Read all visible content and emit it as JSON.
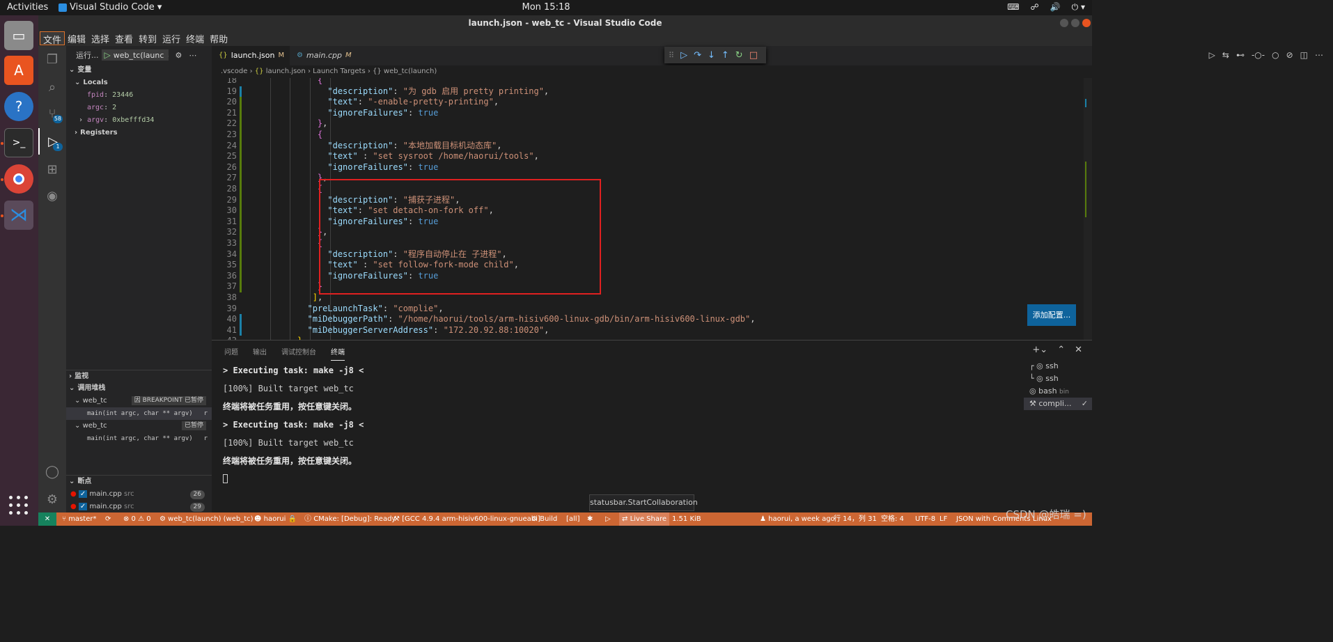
{
  "topbar": {
    "activities": "Activities",
    "app_name": "Visual Studio Code ▾",
    "clock": "Mon 15:18"
  },
  "titlebar": {
    "title": "launch.json - web_tc - Visual Studio Code"
  },
  "menu": [
    "文件",
    "编辑",
    "选择",
    "查看",
    "转到",
    "运行",
    "终端",
    "帮助"
  ],
  "activity": {
    "scm_badge": "58",
    "debug_badge": "1"
  },
  "debug": {
    "run_label": "运行...",
    "config_name": "web_tc(launc",
    "variables_title": "变量",
    "locals_title": "Locals",
    "locals": [
      {
        "name": "fpid",
        "value": "23446"
      },
      {
        "name": "argc",
        "value": "2"
      },
      {
        "name": "argv",
        "value": "0xbefffd34"
      }
    ],
    "registers_title": "Registers",
    "watch_title": "监视",
    "callstack_title": "调用堆栈",
    "threads": [
      {
        "name": "web_tc",
        "status": "因 BREAKPOINT 已暂停",
        "frame": "main(int argc, char ** argv)",
        "frame_tail": "r"
      },
      {
        "name": "web_tc",
        "status": "已暂停",
        "frame": "main(int argc, char ** argv)",
        "frame_tail": "r"
      }
    ],
    "breakpoints_title": "断点",
    "breakpoints": [
      {
        "file": "main.cpp",
        "dir": "src",
        "line": "26"
      },
      {
        "file": "main.cpp",
        "dir": "src",
        "line": "29"
      }
    ]
  },
  "tabs": [
    {
      "label": "launch.json",
      "mark": "M"
    },
    {
      "label": "main.cpp",
      "mark": "M"
    }
  ],
  "breadcrumb": {
    "p1": ".vscode",
    "p2": "launch.json",
    "p3": "Launch Targets",
    "p4": "{} web_tc(launch)"
  },
  "editor": {
    "lines": [
      {
        "n": "18",
        "t": ""
      },
      {
        "n": "19",
        "t": ""
      },
      {
        "n": "20",
        "t": ""
      },
      {
        "n": "21",
        "t": ""
      },
      {
        "n": "22",
        "t": ""
      },
      {
        "n": "23",
        "t": ""
      },
      {
        "n": "24",
        "t": ""
      },
      {
        "n": "25",
        "t": ""
      },
      {
        "n": "26",
        "t": ""
      },
      {
        "n": "27",
        "t": ""
      },
      {
        "n": "28",
        "t": ""
      },
      {
        "n": "29",
        "t": ""
      },
      {
        "n": "30",
        "t": ""
      },
      {
        "n": "31",
        "t": ""
      },
      {
        "n": "32",
        "t": ""
      },
      {
        "n": "33",
        "t": ""
      },
      {
        "n": "34",
        "t": ""
      },
      {
        "n": "35",
        "t": ""
      },
      {
        "n": "36",
        "t": ""
      },
      {
        "n": "37",
        "t": ""
      },
      {
        "n": "38",
        "t": ""
      },
      {
        "n": "39",
        "t": ""
      },
      {
        "n": "40",
        "t": ""
      },
      {
        "n": "41",
        "t": ""
      },
      {
        "n": "42",
        "t": ""
      }
    ],
    "code": [
      [
        "",
        ""
      ],
      [
        "\"description\"",
        "\"为 gdb 启用 pretty printing\""
      ],
      [
        "\"text\"",
        "\"-enable-pretty-printing\""
      ],
      [
        "\"ignoreFailures\"",
        "true"
      ],
      [
        "",
        ""
      ],
      [
        "",
        ""
      ],
      [
        "\"description\"",
        "\"本地加载目标机动态库\""
      ],
      [
        "\"text\"",
        "\"set sysroot /home/haorui/tools\""
      ],
      [
        "\"ignoreFailures\"",
        "true"
      ],
      [
        "",
        ""
      ],
      [
        "",
        ""
      ],
      [
        "\"description\"",
        "\"捕获子进程\""
      ],
      [
        "\"text\"",
        "\"set detach-on-fork off\""
      ],
      [
        "\"ignoreFailures\"",
        "true"
      ],
      [
        "",
        ""
      ],
      [
        "",
        ""
      ],
      [
        "\"description\"",
        "\"程序自动停止在 子进程\""
      ],
      [
        "\"text\"",
        "\"set follow-fork-mode child\""
      ],
      [
        "\"ignoreFailures\"",
        "true"
      ],
      [
        "",
        ""
      ],
      [
        "",
        ""
      ],
      [
        "\"preLaunchTask\"",
        "\"complie\""
      ],
      [
        "\"miDebuggerPath\"",
        "\"/home/haorui/tools/arm-hisiv600-linux-gdb/bin/arm-hisiv600-linux-gdb\""
      ],
      [
        "\"miDebuggerServerAddress\"",
        "\"172.20.92.88:10020\""
      ],
      [
        "",
        ""
      ]
    ],
    "add_config": "添加配置..."
  },
  "panel": {
    "tabs": [
      "问题",
      "输出",
      "调试控制台",
      "终端"
    ],
    "terminal_lines": [
      "> Executing task: make -j8 <",
      "[100%] Built target web_tc",
      "终端将被任务重用，按任意键关闭。",
      "> Executing task: make -j8 <",
      "[100%] Built target web_tc",
      "终端将被任务重用，按任意键关闭。"
    ],
    "terminals": [
      {
        "name": "ssh",
        "sub": ""
      },
      {
        "name": "ssh",
        "sub": ""
      },
      {
        "name": "bash",
        "sub": "bin"
      },
      {
        "name": "compli...",
        "sub": ""
      }
    ]
  },
  "tooltip": "statusbar.StartCollaboration",
  "status": {
    "branch": "master*",
    "problems": "⊗ 0 ⚠ 0",
    "launch": "web_tc(launch) (web_tc)",
    "user": "haorui",
    "cmake": "CMake: [Debug]: Ready",
    "kit": "[GCC 4.9.4 arm-hisiv600-linux-gnueabi]",
    "build": "Build",
    "target": "[all]",
    "liveshare": "Live Share",
    "size": "1.51 KiB",
    "blame": "haorui, a week ago",
    "position": "行 14，列 31",
    "spaces": "空格: 4",
    "encoding": "UTF-8",
    "eol": "LF",
    "language": "JSON with Comments",
    "os": "Linux"
  },
  "watermark": "CSDN @皓瑞 =)"
}
